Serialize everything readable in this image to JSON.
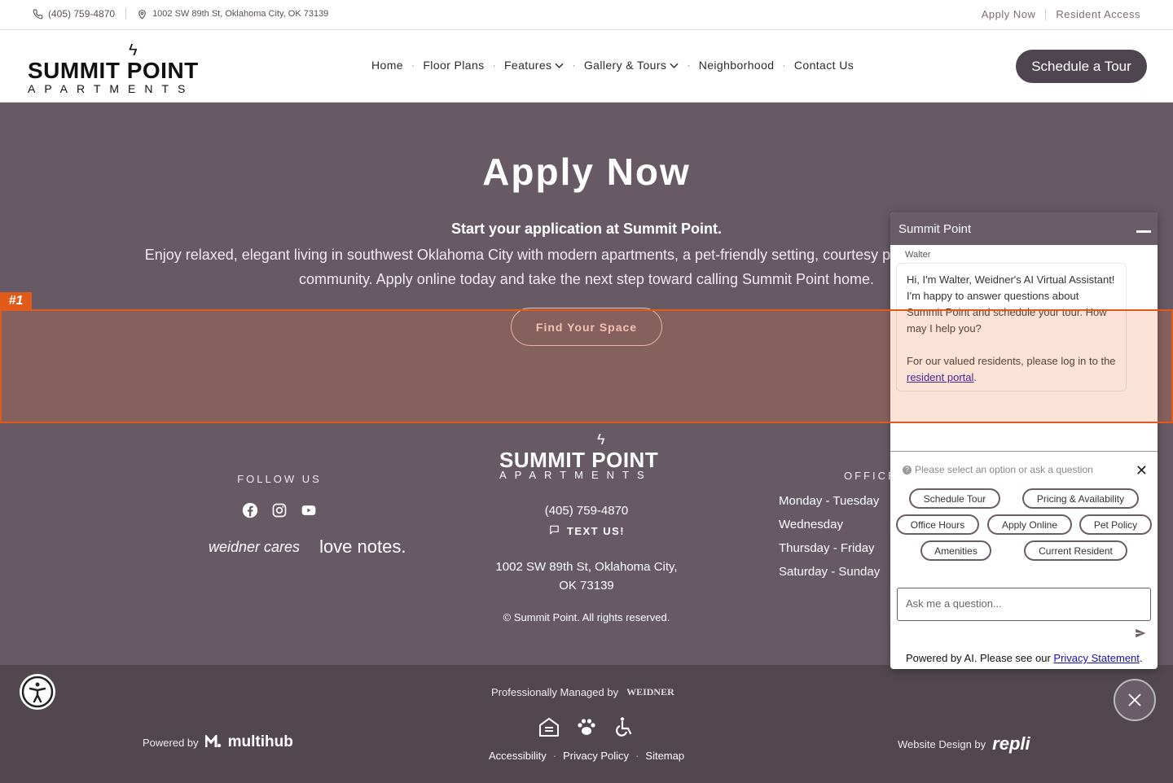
{
  "topbar": {
    "phone": "(405) 759-4870",
    "address": "1002 SW 89th St, Oklahoma City, OK 73139",
    "apply_now": "Apply Now",
    "resident_access": "Resident Access"
  },
  "header": {
    "logo_name": "SUMMIT POINT",
    "logo_sub": "APARTMENTS",
    "nav": [
      "Home",
      "Floor Plans",
      "Features",
      "Gallery & Tours",
      "Neighborhood",
      "Contact Us"
    ],
    "schedule_tour": "Schedule a Tour"
  },
  "hero": {
    "title": "Apply Now",
    "subtitle": "Start your application at Summit Point.",
    "text": "Enjoy relaxed, elegant living in southwest Oklahoma City with modern apartments, a pet-friendly setting, courtesy patrol, and a fenced-in community. Apply online today and take the next step toward calling Summit Point home.",
    "cta": "Find Your Space"
  },
  "annotation": {
    "tag": "#1"
  },
  "footer": {
    "follow_us": "FOLLOW US",
    "partner1": "weidner cares",
    "partner2": "love notes.",
    "logo_name": "SUMMIT POINT",
    "logo_sub": "APARTMENTS",
    "phone": "(405) 759-4870",
    "text_us": "TEXT US!",
    "address": "1002 SW 89th St, Oklahoma City, OK 73139",
    "copyright": "© Summit Point. All rights reserved.",
    "office_title": "OFFICE",
    "hours_days": [
      "Monday - Tuesday",
      "Wednesday",
      "Thursday - Friday",
      "Saturday - Sunday"
    ]
  },
  "bottom": {
    "managed_by": "Professionally Managed by",
    "managed_logo": "WEIDNER",
    "powered_by": "Powered by",
    "powered_logo": "multihub",
    "website_design": "Website Design by",
    "design_logo": "repli",
    "links": [
      "Accessibility",
      "Privacy Policy",
      "Sitemap"
    ]
  },
  "chat": {
    "title": "Summit Point",
    "bot_name": "Walter",
    "greeting": "Hi, I'm Walter, Weidner's AI Virtual Assistant! I'm happy to answer questions about Summit Point and schedule your tour. How may I help you?",
    "resident_text": "For our valued residents, please log in to the",
    "resident_link": "resident portal",
    "hint": "Please select an option or ask a question",
    "options": [
      "Schedule Tour",
      "Pricing & Availability",
      "Office Hours",
      "Apply Online",
      "Pet Policy",
      "Amenities",
      "Current Resident"
    ],
    "input_placeholder": "Ask me a question...",
    "ai_note": "Powered by AI. Please see our",
    "privacy_link": "Privacy Statement"
  }
}
